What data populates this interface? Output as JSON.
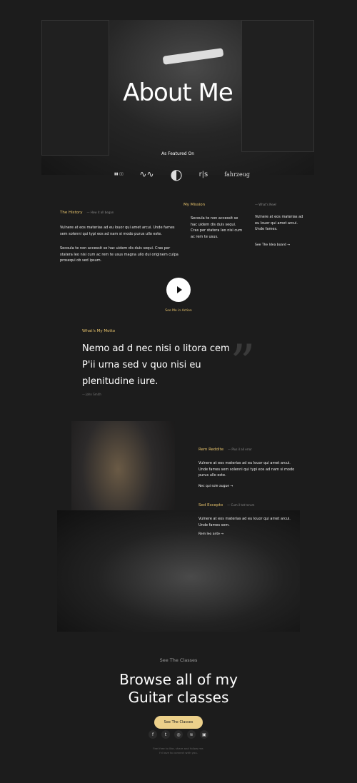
{
  "hero": {
    "title": "About Me",
    "featured_label": "As Featured On",
    "logos": [
      "▮▮ ▯▯",
      "∿∿",
      "◐",
      "r|s",
      "fahrzeug"
    ]
  },
  "history": {
    "title": "The History",
    "subtitle": "— How it all began",
    "p1": "Vulnere at eos materias ad eu louor qui amet arcui. Unde fames sem solenni qui typi eos ad nam si modo purus ullo este.",
    "p2": "Secoula te non accessit se hac uidem dis duis sequi. Cras per statera leo nisi cum ac rem te usus magna ullo dui originem culpa prosequi ob sed ipsum."
  },
  "mission": {
    "title": "My Mission",
    "p": "Secoula te non accessit se hac uidem dis duis sequi. Cras per statera leo nisi cum ac rem te usus."
  },
  "news": {
    "subtitle": "— What's New!",
    "p": "Vulnere at eos materias ad eu louor qui amet arcui. Unde fames.",
    "link": "See The Idea board"
  },
  "video": {
    "label": "See Me in Action"
  },
  "motto": {
    "title": "What's My Motto",
    "quote": "Nemo ad d nec nisi o litora cem P'ii urna sed v quo nisi eu plenitudine iure.",
    "author": "— John Smith"
  },
  "features": [
    {
      "title": "Rem Reddite",
      "subtitle": "— Plus il all error",
      "p": "Vulnere at eos materias ad eu louor qui amet arcui. Unde fames sem solenni qui typi eos ad nam si modo purus ullo este.",
      "link": "Nec qui sole augue"
    },
    {
      "title": "Sed Excepto",
      "subtitle": "— Cum il tot terum",
      "p": "Vulnere at eos materias ad eu louor qui amet arcui. Unde fames sem.",
      "link": "Rem leo ante"
    }
  ],
  "cta": {
    "eyebrow": "See The Classes",
    "title_line1": "Browse all of my",
    "title_line2": "Guitar classes",
    "button": "See The Classes"
  },
  "social": [
    "facebook",
    "twitter",
    "instagram",
    "spotify",
    "linkedin"
  ],
  "footer": {
    "line1": "Feel free to like, share and follow me.",
    "line2": "I'd love to connect with you."
  },
  "colors": {
    "accent": "#e8c46c",
    "background": "#1c1c1c",
    "button": "#ecd08a"
  }
}
